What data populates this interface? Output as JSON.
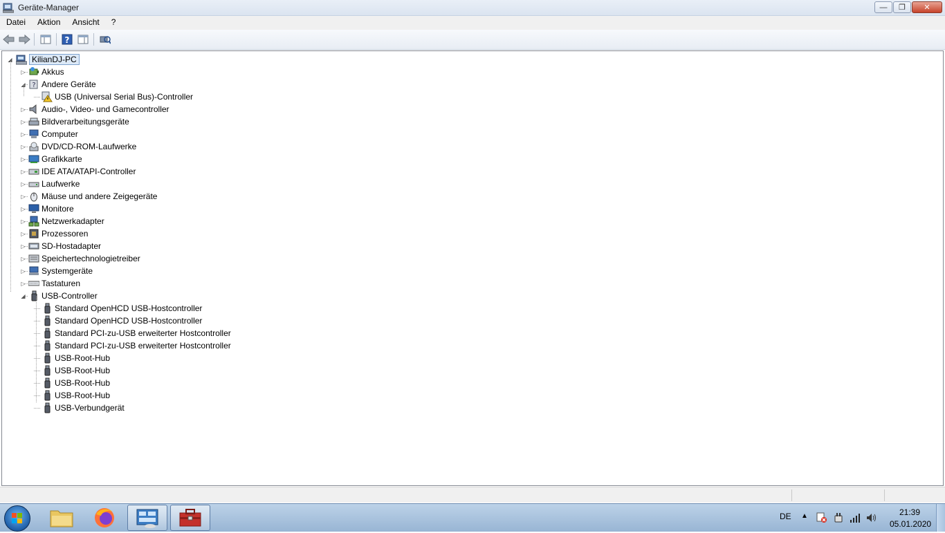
{
  "window": {
    "title": "Geräte-Manager"
  },
  "menu": [
    "Datei",
    "Aktion",
    "Ansicht",
    "?"
  ],
  "tree": {
    "root": "KilianDJ-PC",
    "items": [
      {
        "label": "Akkus",
        "level": 1,
        "expander": "collapsed",
        "icon": "battery-icon"
      },
      {
        "label": "Andere Geräte",
        "level": 1,
        "expander": "expanded",
        "icon": "unknown-device-icon"
      },
      {
        "label": "USB (Universal Serial Bus)-Controller",
        "level": 2,
        "expander": "none",
        "icon": "warning-device-icon"
      },
      {
        "label": "Audio-, Video- und Gamecontroller",
        "level": 1,
        "expander": "collapsed",
        "icon": "speaker-icon"
      },
      {
        "label": "Bildverarbeitungsgeräte",
        "level": 1,
        "expander": "collapsed",
        "icon": "scanner-icon"
      },
      {
        "label": "Computer",
        "level": 1,
        "expander": "collapsed",
        "icon": "computer-icon"
      },
      {
        "label": "DVD/CD-ROM-Laufwerke",
        "level": 1,
        "expander": "collapsed",
        "icon": "cdrom-icon"
      },
      {
        "label": "Grafikkarte",
        "level": 1,
        "expander": "collapsed",
        "icon": "display-adapter-icon"
      },
      {
        "label": "IDE ATA/ATAPI-Controller",
        "level": 1,
        "expander": "collapsed",
        "icon": "ide-controller-icon"
      },
      {
        "label": "Laufwerke",
        "level": 1,
        "expander": "collapsed",
        "icon": "disk-drive-icon"
      },
      {
        "label": "Mäuse und andere Zeigegeräte",
        "level": 1,
        "expander": "collapsed",
        "icon": "mouse-icon"
      },
      {
        "label": "Monitore",
        "level": 1,
        "expander": "collapsed",
        "icon": "monitor-icon"
      },
      {
        "label": "Netzwerkadapter",
        "level": 1,
        "expander": "collapsed",
        "icon": "network-adapter-icon"
      },
      {
        "label": "Prozessoren",
        "level": 1,
        "expander": "collapsed",
        "icon": "processor-icon"
      },
      {
        "label": "SD-Hostadapter",
        "level": 1,
        "expander": "collapsed",
        "icon": "sd-host-icon"
      },
      {
        "label": "Speichertechnologietreiber",
        "level": 1,
        "expander": "collapsed",
        "icon": "storage-driver-icon"
      },
      {
        "label": "Systemgeräte",
        "level": 1,
        "expander": "collapsed",
        "icon": "system-device-icon"
      },
      {
        "label": "Tastaturen",
        "level": 1,
        "expander": "collapsed",
        "icon": "keyboard-icon"
      },
      {
        "label": "USB-Controller",
        "level": 1,
        "expander": "expanded",
        "icon": "usb-icon"
      },
      {
        "label": "Standard OpenHCD USB-Hostcontroller",
        "level": 2,
        "expander": "none",
        "icon": "usb-icon"
      },
      {
        "label": "Standard OpenHCD USB-Hostcontroller",
        "level": 2,
        "expander": "none",
        "icon": "usb-icon"
      },
      {
        "label": "Standard PCI-zu-USB erweiterter Hostcontroller",
        "level": 2,
        "expander": "none",
        "icon": "usb-icon"
      },
      {
        "label": "Standard PCI-zu-USB erweiterter Hostcontroller",
        "level": 2,
        "expander": "none",
        "icon": "usb-icon"
      },
      {
        "label": "USB-Root-Hub",
        "level": 2,
        "expander": "none",
        "icon": "usb-icon"
      },
      {
        "label": "USB-Root-Hub",
        "level": 2,
        "expander": "none",
        "icon": "usb-icon"
      },
      {
        "label": "USB-Root-Hub",
        "level": 2,
        "expander": "none",
        "icon": "usb-icon"
      },
      {
        "label": "USB-Root-Hub",
        "level": 2,
        "expander": "none",
        "icon": "usb-icon"
      },
      {
        "label": "USB-Verbundgerät",
        "level": 2,
        "expander": "none",
        "icon": "usb-icon"
      }
    ]
  },
  "taskbar": {
    "language": "DE",
    "time": "21:39",
    "date": "05.01.2020"
  },
  "colors": {
    "taskbar": "#a9c3df",
    "selection": "#dce9f7",
    "close_button": "#c7432a"
  }
}
